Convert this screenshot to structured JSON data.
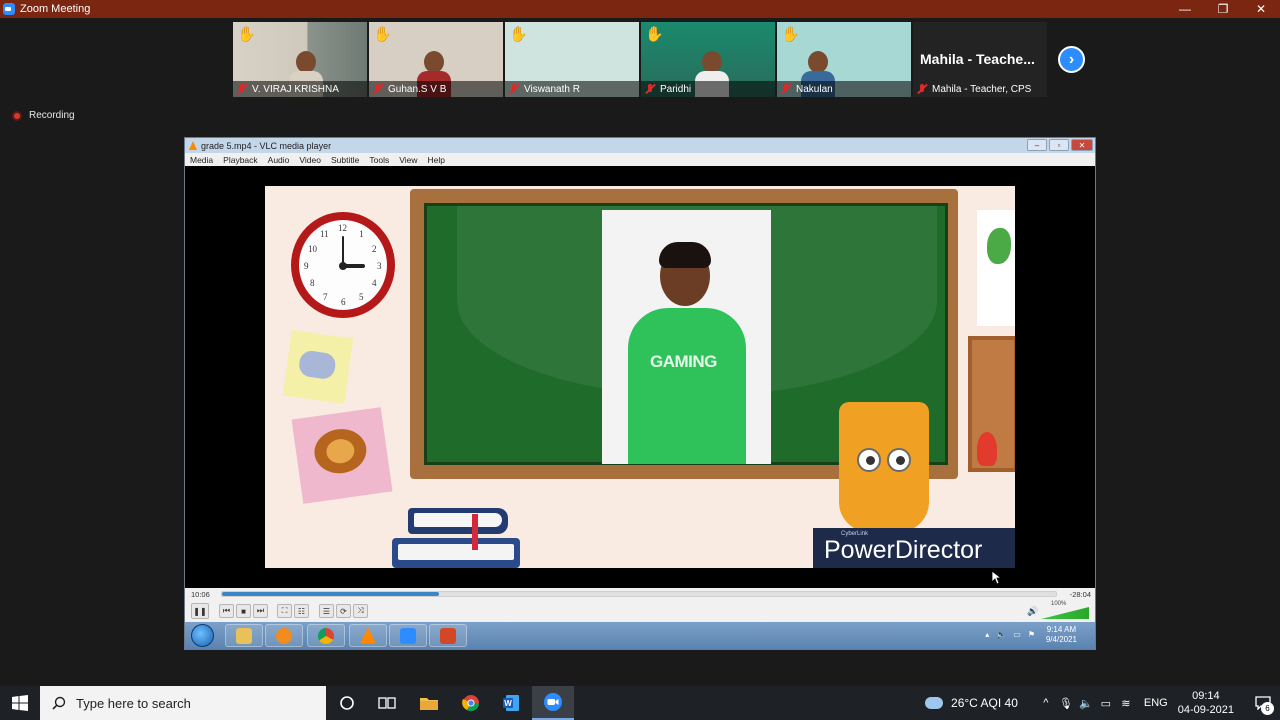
{
  "window": {
    "title": "Zoom Meeting",
    "controls": {
      "minimize": "—",
      "restore": "❐",
      "close": "✕"
    }
  },
  "gallery": {
    "participants": [
      {
        "name": "V.   VIRAJ   KRISHNA",
        "hand_raised": true,
        "muted": true
      },
      {
        "name": "Guhan.S V  B",
        "hand_raised": true,
        "muted": true
      },
      {
        "name": "Viswanath R",
        "hand_raised": true,
        "muted": true
      },
      {
        "name": "Paridhi",
        "hand_raised": true,
        "muted": true
      },
      {
        "name": "Nakulan",
        "hand_raised": true,
        "muted": true
      },
      {
        "name": "Mahila - Teacher, CPS",
        "display_name": "Mahila  -  Teache...",
        "hand_raised": false,
        "muted": true
      }
    ],
    "next_icon": "chevron-right-icon"
  },
  "recording": {
    "label": "Recording"
  },
  "vlc": {
    "title": "grade 5.mp4 - VLC media player",
    "menu": [
      "Media",
      "Playback",
      "Audio",
      "Video",
      "Subtitle",
      "Tools",
      "View",
      "Help"
    ],
    "time_elapsed": "10:06",
    "time_remaining": "-28:04",
    "progress_fraction": 0.26,
    "volume_label": "100%",
    "video": {
      "clock_numbers": [
        "12",
        "1",
        "2",
        "3",
        "4",
        "5",
        "6",
        "7",
        "8",
        "9",
        "10",
        "11"
      ],
      "shirt_text": "GAMING",
      "watermark_small": "CyberLink",
      "watermark": "PowerDirector"
    },
    "win7_clock": {
      "time": "9:14 AM",
      "date": "9/4/2021"
    }
  },
  "taskbar": {
    "search_placeholder": "Type here to search",
    "weather": "26°C  AQI 40",
    "language": "ENG",
    "time": "09:14",
    "date": "04-09-2021",
    "notification_count": "6"
  }
}
